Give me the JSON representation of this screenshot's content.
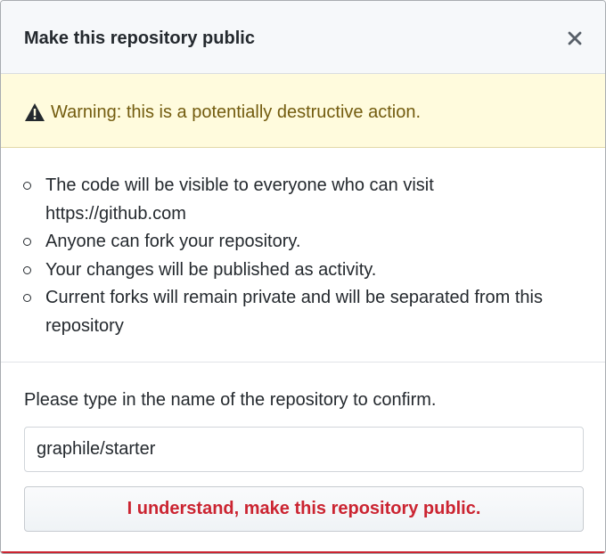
{
  "dialog": {
    "title": "Make this repository public",
    "close_icon": "close-icon"
  },
  "warning": {
    "icon": "alert-icon",
    "text": "Warning: this is a potentially destructive action.",
    "background": "#fffbdd",
    "text_color": "#735c0f"
  },
  "consequences": [
    {
      "text": "The code will be visible to everyone who can visit https://github.com"
    },
    {
      "text": "Anyone can fork your repository."
    },
    {
      "text": "Your changes will be published as activity."
    },
    {
      "text": "Current forks will remain private and will be separated from this repository"
    }
  ],
  "confirm": {
    "label": "Please type in the name of the repository to confirm.",
    "input_value": "graphile/starter"
  },
  "action": {
    "label": "I understand, make this repository public.",
    "color": "#cb2431"
  }
}
